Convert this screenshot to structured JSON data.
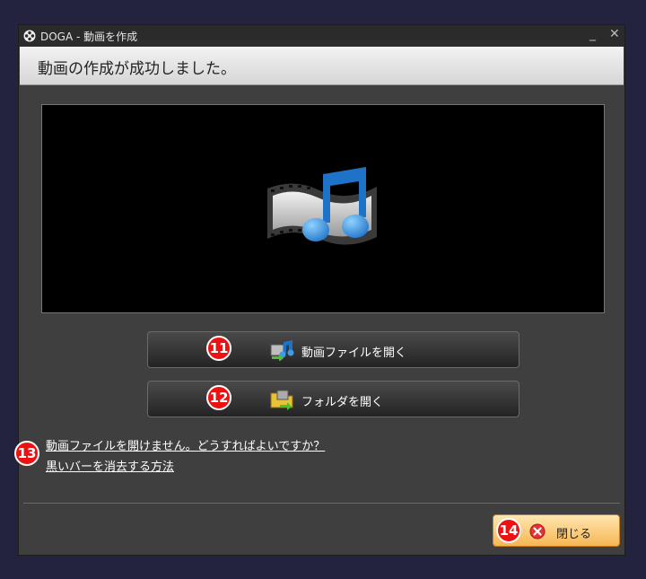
{
  "window": {
    "title": "DOGA - 動画を作成",
    "minimize_glyph": "_",
    "close_glyph": "✕"
  },
  "banner": {
    "message": "動画の作成が成功しました。"
  },
  "preview": {
    "icon": "film-music-icon"
  },
  "actions": {
    "open_file_label": "動画ファイルを開く",
    "open_folder_label": "フォルダを開く"
  },
  "help_links": [
    {
      "text": "動画ファイルを開けません。どうすればよいですか？"
    },
    {
      "text": "黒いバーを消去する方法"
    }
  ],
  "footer": {
    "close_label": "閉じる"
  },
  "callouts": [
    "11",
    "12",
    "13",
    "14"
  ],
  "colors": {
    "callout": "#ee1111",
    "close_button": "#f6b755",
    "film_note": "#1e73c8"
  }
}
